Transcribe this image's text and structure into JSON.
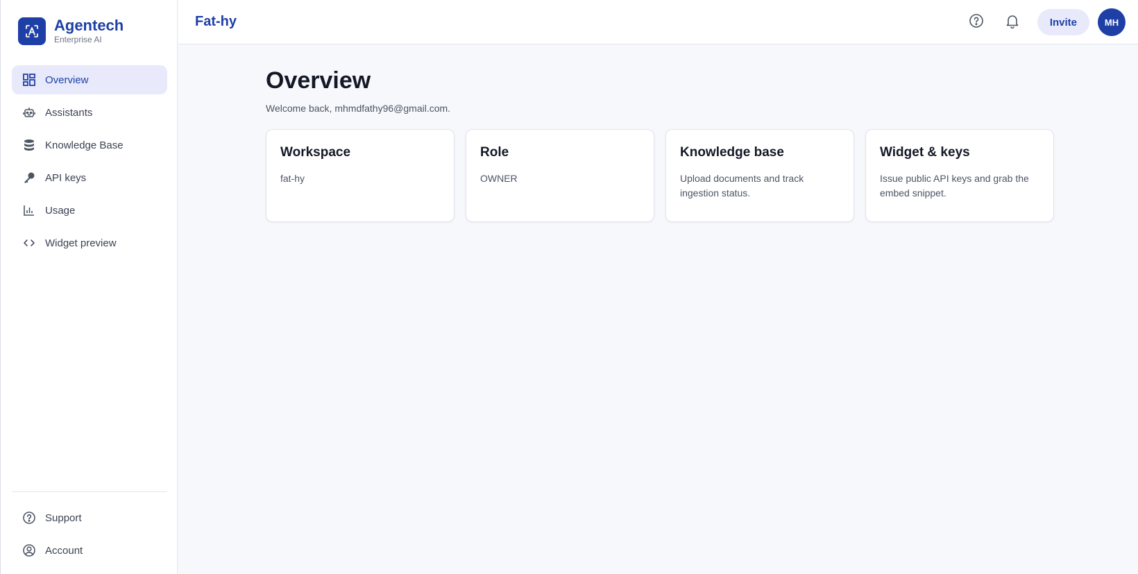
{
  "brand": {
    "name": "Agentech",
    "subtitle": "Enterprise AI"
  },
  "sidebar": {
    "items": [
      {
        "label": "Overview",
        "icon": "dashboard-icon",
        "active": true
      },
      {
        "label": "Assistants",
        "icon": "robot-icon"
      },
      {
        "label": "Knowledge Base",
        "icon": "database-icon"
      },
      {
        "label": "API keys",
        "icon": "key-icon"
      },
      {
        "label": "Usage",
        "icon": "bar-chart-icon"
      },
      {
        "label": "Widget preview",
        "icon": "code-icon"
      }
    ],
    "bottom": [
      {
        "label": "Support",
        "icon": "help-circle-icon"
      },
      {
        "label": "Account",
        "icon": "user-circle-icon"
      }
    ]
  },
  "header": {
    "workspace": "Fat-hy",
    "invite_label": "Invite",
    "avatar_initials": "MH"
  },
  "main": {
    "title": "Overview",
    "welcome": "Welcome back, mhmdfathy96@gmail.com.",
    "cards": [
      {
        "title": "Workspace",
        "body": "fat-hy"
      },
      {
        "title": "Role",
        "body": "OWNER"
      },
      {
        "title": "Knowledge base",
        "body": "Upload documents and track ingestion status."
      },
      {
        "title": "Widget & keys",
        "body": "Issue public API keys and grab the embed snippet."
      }
    ]
  },
  "colors": {
    "accent": "#1d3fa6",
    "accent_soft": "#e8eafb",
    "background": "#f7f8fc"
  }
}
